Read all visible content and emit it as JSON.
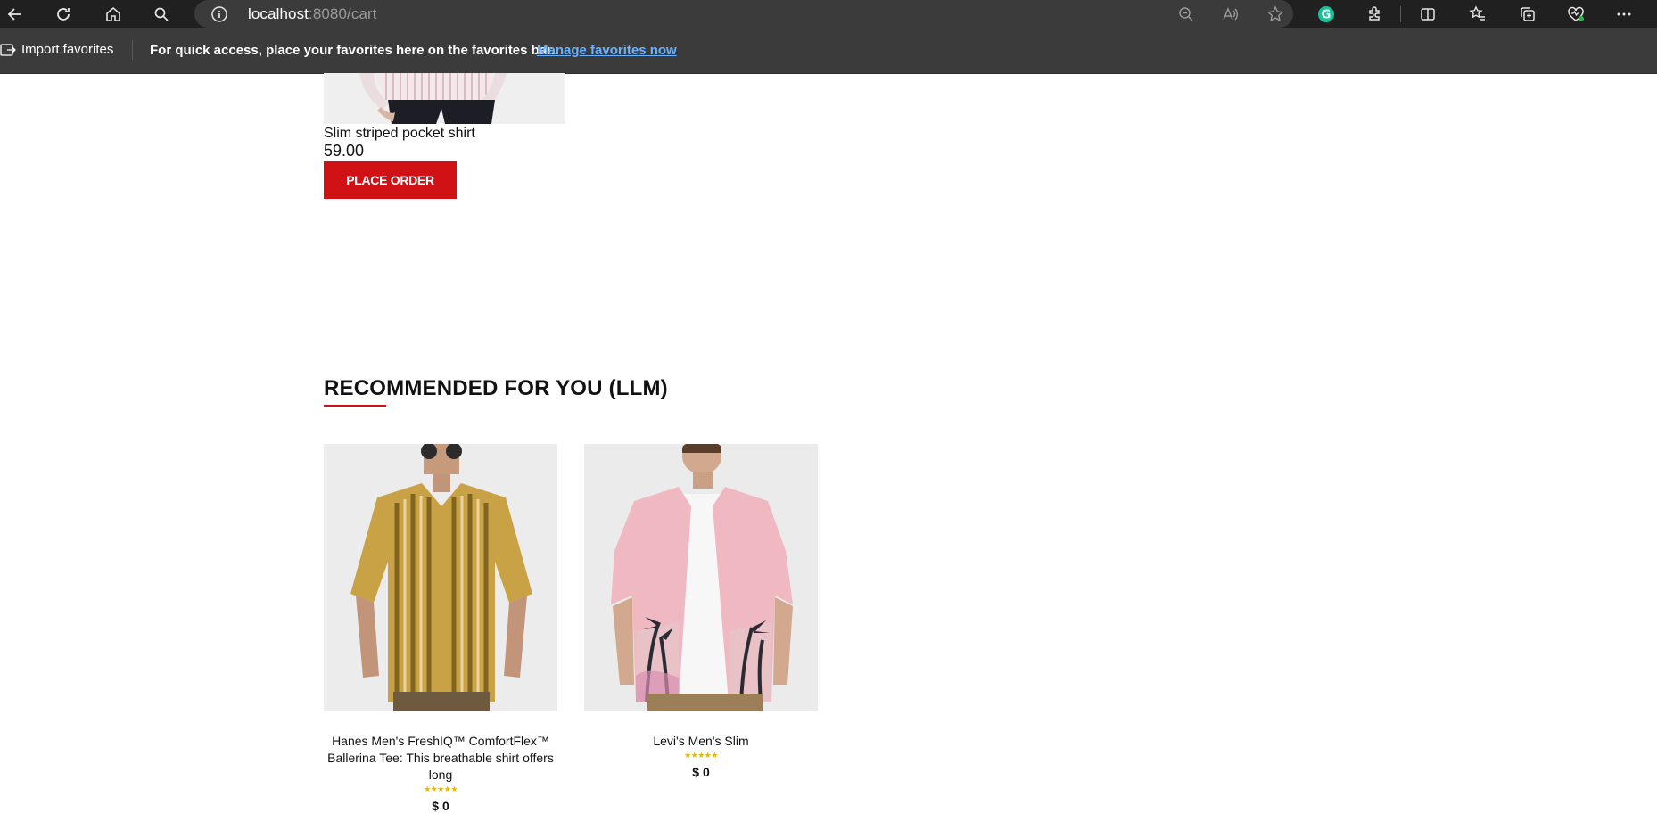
{
  "browser": {
    "url_host": "localhost",
    "url_rest": ":8080/cart",
    "import_favorites": "Import favorites",
    "favorites_message": "For quick access, place your favorites here on the favorites bar.",
    "favorites_link": "Manage favorites now",
    "icons": [
      "back-icon",
      "refresh-icon",
      "home-icon",
      "search-icon",
      "info-icon",
      "zoom-out-icon",
      "read-aloud-icon",
      "favorite-star-icon",
      "grammarly-icon",
      "extensions-icon",
      "split-screen-icon",
      "favorites-icon",
      "collections-icon",
      "browser-essentials-icon",
      "more-icon"
    ]
  },
  "cart": {
    "item_name": "Slim striped pocket shirt",
    "item_price": "59.00",
    "place_order_label": "PLACE ORDER"
  },
  "recommended": {
    "title": "RECOMMENDED FOR YOU (LLM)",
    "items": [
      {
        "title": "Hanes Men's FreshIQ™ ComfortFlex™ Ballerina Tee: This breathable shirt offers long",
        "rating": 5,
        "stars": "★★★★★",
        "price": "$ 0"
      },
      {
        "title": "Levi's Men's Slim",
        "rating": 5,
        "stars": "★★★★★",
        "price": "$ 0"
      }
    ]
  }
}
